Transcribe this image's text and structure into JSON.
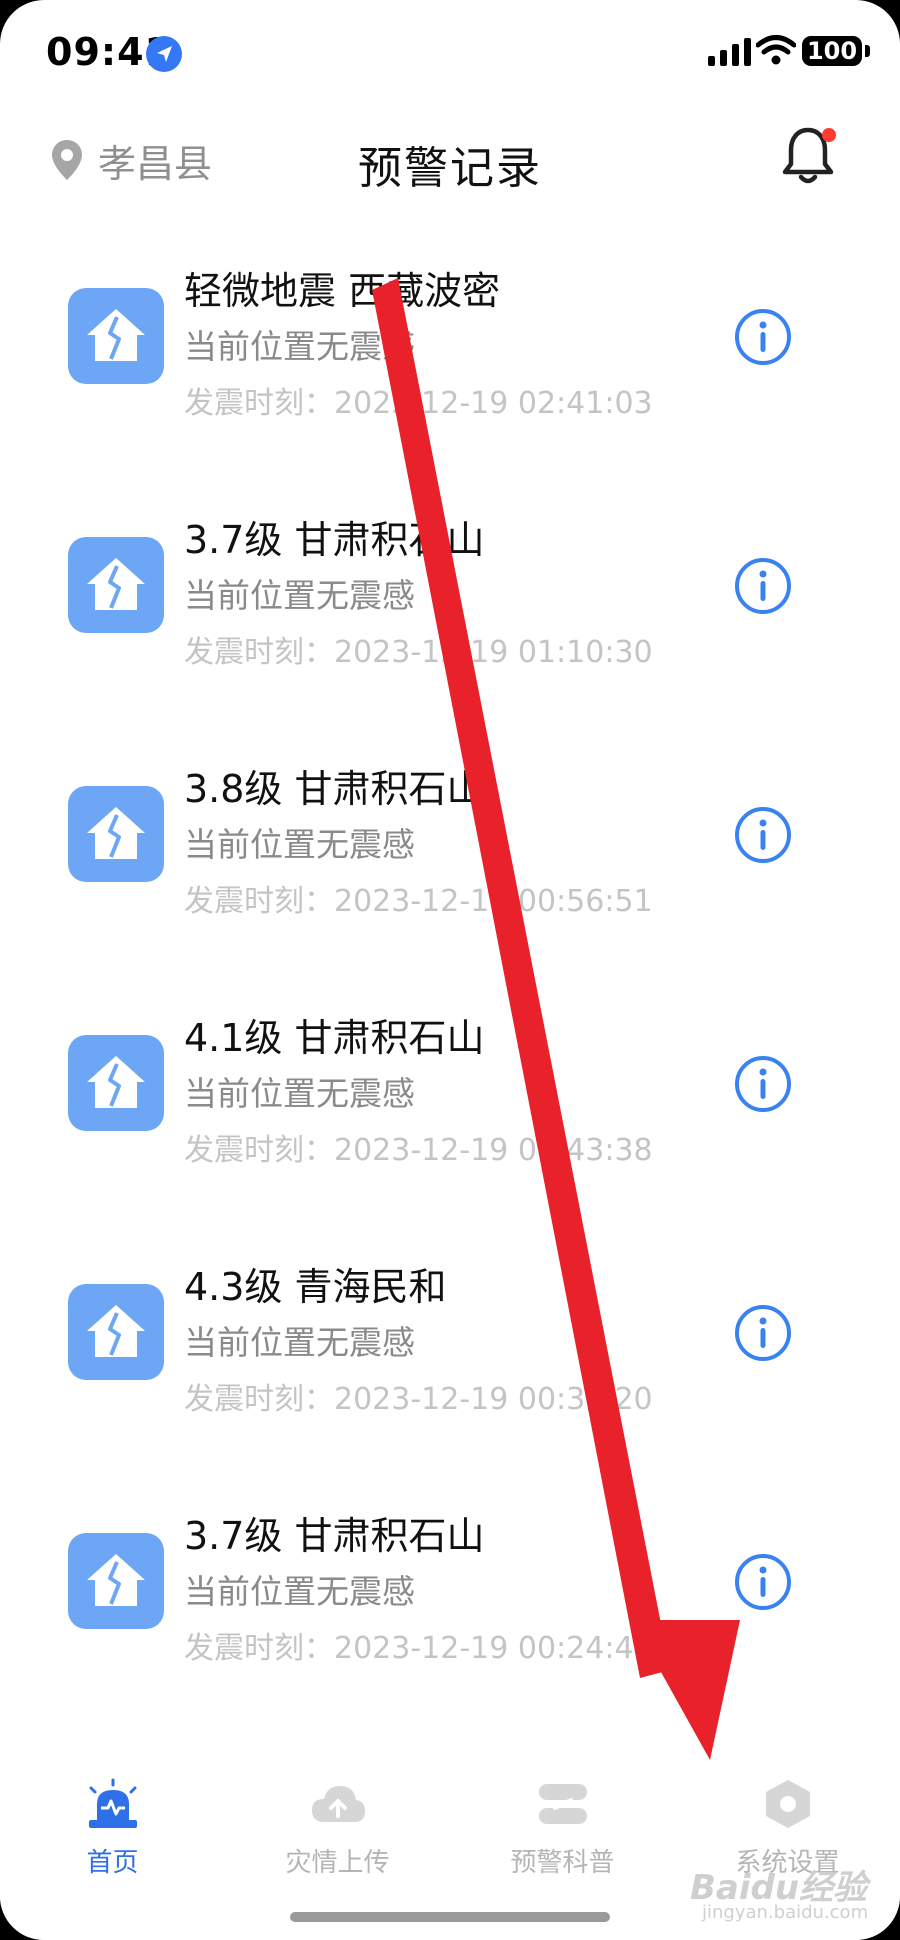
{
  "status_bar": {
    "time": "09:41",
    "battery": "100",
    "icons": [
      "location-arrow-icon",
      "signal-icon",
      "wifi-icon",
      "battery-icon"
    ]
  },
  "header": {
    "location": "孝昌县",
    "title": "预警记录",
    "notification_badge_color": "#ff3b30"
  },
  "records": [
    {
      "title": "轻微地震 西藏波密",
      "subtitle": "当前位置无震感",
      "time": "发震时刻：2023-12-19 02:41:03"
    },
    {
      "title": "3.7级 甘肃积石山",
      "subtitle": "当前位置无震感",
      "time": "发震时刻：2023-12-19 01:10:30"
    },
    {
      "title": "3.8级 甘肃积石山",
      "subtitle": "当前位置无震感",
      "time": "发震时刻：2023-12-19 00:56:51"
    },
    {
      "title": "4.1级 甘肃积石山",
      "subtitle": "当前位置无震感",
      "time": "发震时刻：2023-12-19 00:43:38"
    },
    {
      "title": "4.3级 青海民和",
      "subtitle": "当前位置无震感",
      "time": "发震时刻：2023-12-19 00:36:20"
    },
    {
      "title": "3.7级 甘肃积石山",
      "subtitle": "当前位置无震感",
      "time": "发震时刻：2023-12-19 00:24:49"
    }
  ],
  "tabs": [
    {
      "label": "首页",
      "icon": "alarm-siren-icon",
      "active": true
    },
    {
      "label": "灾情上传",
      "icon": "cloud-upload-icon",
      "active": false
    },
    {
      "label": "预警科普",
      "icon": "layers-icon",
      "active": false
    },
    {
      "label": "系统设置",
      "icon": "hexagon-settings-icon",
      "active": false
    }
  ],
  "watermark": {
    "text": "Baidu经验",
    "sub": "jingyan.baidu.com"
  },
  "colors": {
    "accent": "#2f6fe8",
    "item_icon_bg": "#6ea6f6",
    "annotation_arrow": "#e8212a"
  }
}
